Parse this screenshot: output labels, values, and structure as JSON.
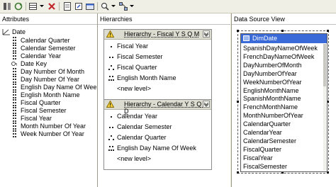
{
  "toolbar": {
    "icons": [
      "add-attribute-icon",
      "refresh-icon",
      "table-icon",
      "delete-icon",
      "properties-icon",
      "new-named-query-icon",
      "show-table-icon",
      "zoom-icon",
      "layout-icon"
    ]
  },
  "attributes": {
    "header": "Attributes",
    "root": "Date",
    "items": [
      "Calendar Quarter",
      "Calendar Semester",
      "Calendar Year",
      "Date Key",
      "Day Number Of Month",
      "Day Number Of Year",
      "English Day Name Of Week",
      "English Month Name",
      "Fiscal Quarter",
      "Fiscal Semester",
      "Fiscal Year",
      "Month Number Of Year",
      "Week Number Of Year"
    ]
  },
  "hierarchies": {
    "header": "Hierarchies",
    "boxes": [
      {
        "title": "Hierarchy - Fiscal Y S Q M",
        "levels": [
          "Fiscal Year",
          "Fiscal Semester",
          "Fiscal Quarter",
          "English Month Name"
        ],
        "new_level": "<new level>"
      },
      {
        "title": "Hierarchy - Calendar Y S Q M D",
        "levels": [
          "Calendar Year",
          "Calendar Semester",
          "Calendar Quarter",
          "English Day Name Of Week"
        ],
        "new_level": "<new level>"
      }
    ]
  },
  "dsv": {
    "header": "Data Source View",
    "table": "DimDate",
    "columns": [
      "SpanishDayNameOfWeek",
      "FrenchDayNameOfWeek",
      "DayNumberOfMonth",
      "DayNumberOfYear",
      "WeekNumberOfYear",
      "EnglishMonthName",
      "SpanishMonthName",
      "FrenchMonthName",
      "MonthNumberOfYear",
      "CalendarQuarter",
      "CalendarYear",
      "CalendarSemester",
      "FiscalQuarter",
      "FiscalYear",
      "FiscalSemester"
    ]
  }
}
